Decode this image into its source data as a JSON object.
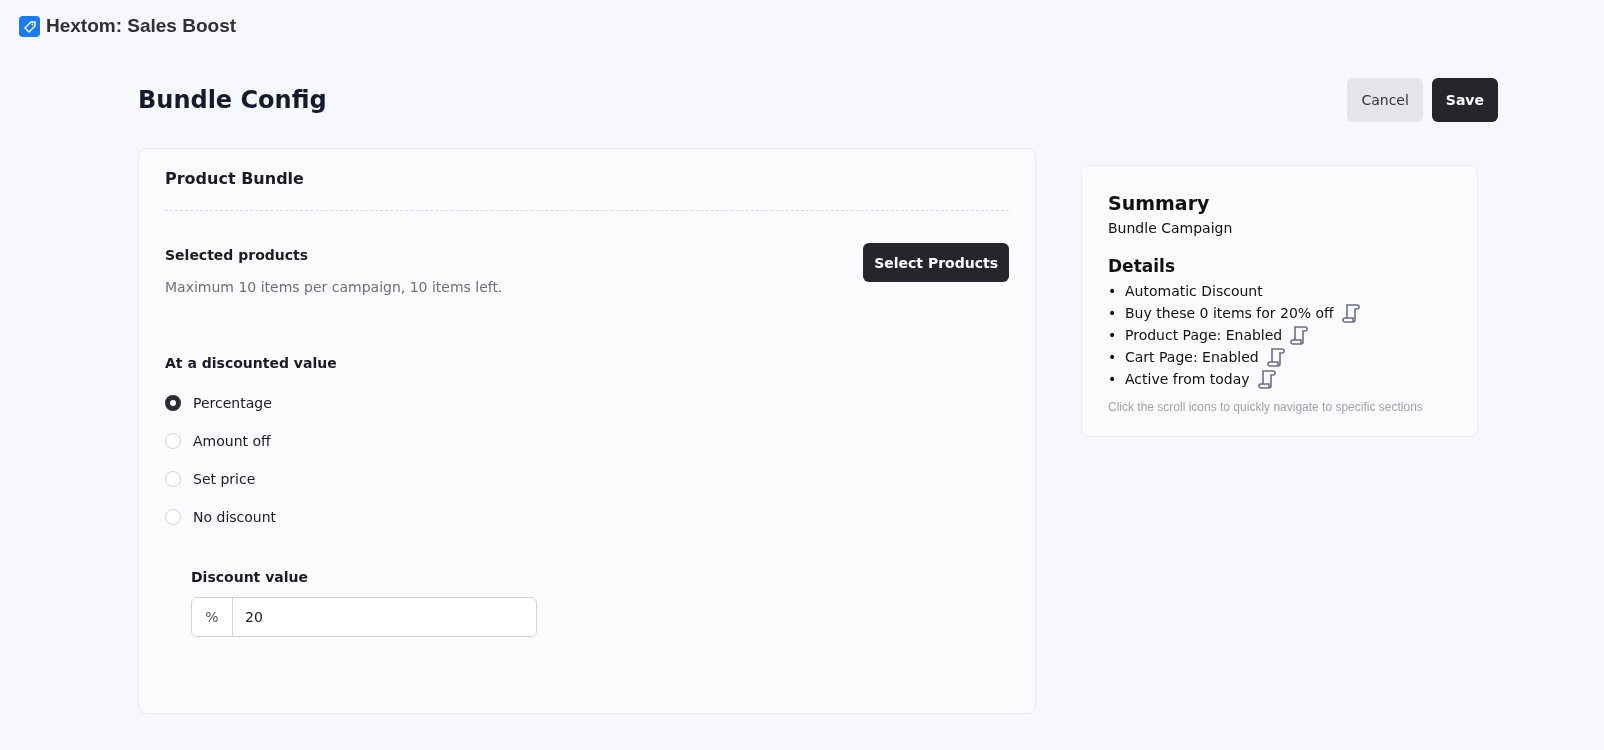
{
  "app": {
    "title": "Hextom: Sales Boost"
  },
  "page": {
    "title": "Bundle Config",
    "buttons": [
      {
        "label": "Cancel",
        "kind": "secondary"
      },
      {
        "label": "Save",
        "kind": "primary"
      }
    ]
  },
  "product_bundle": {
    "title": "Product Bundle",
    "selected_products": {
      "label": "Selected products",
      "hint": "Maximum 10 items per campaign, 10 items left.",
      "button": "Select Products"
    },
    "discount": {
      "label": "At a discounted value",
      "options": [
        {
          "label": "Percentage",
          "selected": true
        },
        {
          "label": "Amount off",
          "selected": false
        },
        {
          "label": "Set price",
          "selected": false
        },
        {
          "label": "No discount",
          "selected": false
        }
      ],
      "value_field": {
        "label": "Discount value",
        "prefix": "%",
        "value": "20"
      }
    }
  },
  "summary": {
    "title": "Summary",
    "subtitle": "Bundle Campaign",
    "details_title": "Details",
    "details": [
      {
        "bullet": "•",
        "text": "Automatic Discount",
        "kind": "plain"
      },
      {
        "bullet": "•",
        "text": "Buy these 0 items for 20% off",
        "kind": "link"
      },
      {
        "bullet": "•",
        "text": "Product Page: Enabled",
        "kind": "link"
      },
      {
        "bullet": "•",
        "text": "Cart Page: Enabled",
        "kind": "link"
      },
      {
        "bullet": "•",
        "text": "Active from today",
        "kind": "link"
      }
    ],
    "note": "Click the scroll icons to quickly navigate to specific sections"
  }
}
